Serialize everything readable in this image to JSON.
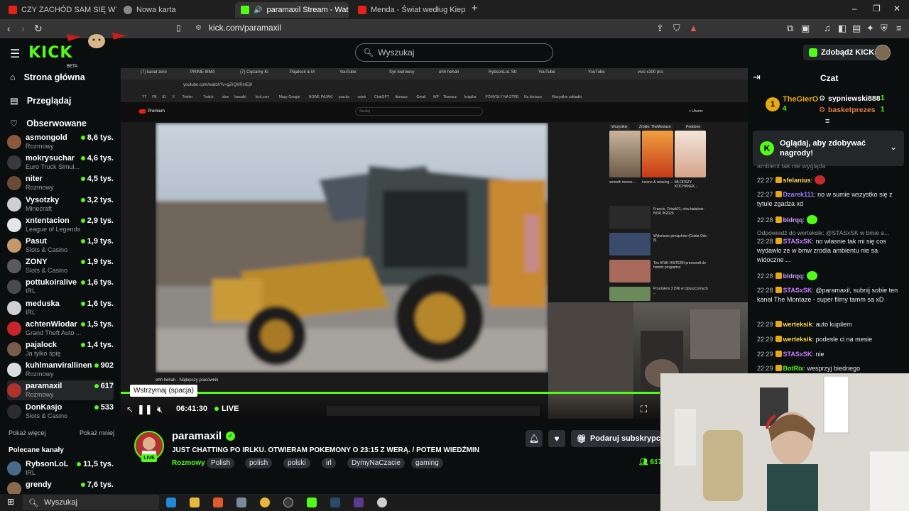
{
  "browser": {
    "tabs": [
      {
        "label": "CZY ZACHÓD SAM SIĘ WYKOŃCZY?",
        "color": "#e62117"
      },
      {
        "label": "Nowa karta",
        "color": "#888"
      },
      {
        "label": "paramaxil Stream - Watch Live",
        "color": "#53fc18"
      },
      {
        "label": "Menda - Świat według Kiepskich - C",
        "color": "#e62117"
      }
    ],
    "url": "kick.com/paramaxil"
  },
  "header": {
    "logo": "KICK",
    "beta": "BETA",
    "search_placeholder": "Wyszukaj",
    "kicks_button": "Zdobądź KICKs"
  },
  "sidebar": {
    "nav": [
      {
        "label": "Strona główna",
        "icon": "home-icon"
      },
      {
        "label": "Przeglądaj",
        "icon": "browse-icon"
      },
      {
        "label": "Obserwowane",
        "icon": "heart-icon"
      }
    ],
    "followed": [
      {
        "name": "asmongold",
        "category": "Rozmowy",
        "viewers": "8,6 tys.",
        "color": "#8b5a3c"
      },
      {
        "name": "mokrysuchar",
        "category": "Euro Truck Simul...",
        "viewers": "4,6 tys.",
        "color": "#3a3a3a"
      },
      {
        "name": "niter",
        "category": "Rozmowy",
        "viewers": "4,5 tys.",
        "color": "#6b4a3a"
      },
      {
        "name": "Vysotzky",
        "category": "Minecraft",
        "viewers": "3,2 tys.",
        "color": "#cfcfcf"
      },
      {
        "name": "xntentacion",
        "category": "League of Legends",
        "viewers": "2,9 tys.",
        "color": "#e6e6e6"
      },
      {
        "name": "Pasut",
        "category": "Slots & Casino",
        "viewers": "1,9 tys.",
        "color": "#c49a6c"
      },
      {
        "name": "ZONY",
        "category": "Slots & Casino",
        "viewers": "1,9 tys.",
        "color": "#5a5a5a"
      },
      {
        "name": "pottukoiralive",
        "category": "IRL",
        "viewers": "1,6 tys.",
        "color": "#4a4a4a"
      },
      {
        "name": "meduska",
        "category": "IRL",
        "viewers": "1,6 tys.",
        "color": "#d0d0d0"
      },
      {
        "name": "achtenWlodar",
        "category": "Grand Theft Auto ...",
        "viewers": "1,5 tys.",
        "color": "#c8262c"
      },
      {
        "name": "pajalock",
        "category": "Ja tylko śpię",
        "viewers": "1,4 tys.",
        "color": "#7a5a4a"
      },
      {
        "name": "kuhlmanvirallinen",
        "category": "Rozmowy",
        "viewers": "902",
        "color": "#dcdcdc"
      },
      {
        "name": "paramaxil",
        "category": "Rozmowy",
        "viewers": "617",
        "color": "#b0322c"
      },
      {
        "name": "DonKasjo",
        "category": "Slots & Casino",
        "viewers": "533",
        "color": "#2c2c2c"
      }
    ],
    "show_more": "Pokaż więcej",
    "show_less": "Pokaż mniej",
    "recommended_title": "Polecane kanały",
    "recommended": [
      {
        "name": "RybsonLoL",
        "category": "IRL",
        "viewers": "11,5 tys.",
        "color": "#4a6a8a"
      },
      {
        "name": "grendy",
        "category": "",
        "viewers": "7,6 tys.",
        "color": "#8a6a4a"
      }
    ]
  },
  "video": {
    "inner_tabs": [
      "(7) kanał zero",
      "PRIME MMA",
      "(7) Ciężarny Ki",
      "Pajalock & M",
      "YouTube",
      "Syn kierowcy",
      "ehh hehah",
      "RybsonLoL Str",
      "YouTube",
      "YouTube",
      "vivo x200 pro"
    ],
    "inner_url": "youtube.com/watch?v=gZrQKRmEj0",
    "bookmarks": [
      "YT",
      "FB",
      "IG",
      "X",
      "Twitter",
      "Twitch",
      "sbm",
      "kawałki",
      "kick.com",
      "Mapy Google",
      "NOWE PAJAKI",
      "pracka",
      "sejek",
      "ChatGPT",
      "tłumacz",
      "Gmail",
      "WP",
      "Tłumacz",
      "książka",
      "POMYSŁY NA STRE",
      "Na bieżąco",
      "Wszystkie zakładki"
    ],
    "yt_search": "Szukaj",
    "yt_premium": "Premium",
    "yt_upload": "+ Utwórz",
    "yt_chips": [
      "Wszystkie",
      "Źródło: TheMontaze",
      "Podobne"
    ],
    "side_items": [
      "smooth moves ...",
      "insane & relaxing ...",
      "MŁODSZY KOCHANEK...",
      "Francis, Oriwik21, nów bałaśnie - NOR IN2026",
      "Wykolunie pimiąchów (Gołda Odc. 8)",
      "Ten ATAK HISTERII przeszedł do historii programu!",
      "Przeżyłem 3 DNI w Opuszczonych ..."
    ],
    "caption": "ehh hehah - Najlepszy pracownik",
    "tooltip": "Wstrzymaj (spacja)",
    "time": "06:41:30",
    "live_label": "LIVE",
    "progress_fraction": 0.86
  },
  "stream": {
    "name": "paramaxil",
    "live_badge": "LIVE",
    "title": "JUST CHATTING PO IRLKU. OTWIERAM POKEMONY O 23:15 Z WERĄ. / POTEM WIEDŹMIN",
    "category": "Rozmowy",
    "tags": [
      "Polish",
      "polish",
      "polski",
      "irl",
      "DymyNaCzacie",
      "gaming"
    ],
    "subscribe_button": "Podaruj subskrypcje",
    "viewers": "617"
  },
  "chat": {
    "title": "Czat",
    "top_gifters": [
      {
        "rank": "1",
        "name": "TheGierO",
        "count": "4"
      },
      {
        "name": "sypniewski888",
        "count": "1"
      },
      {
        "name": "basketprezes",
        "count": "1"
      }
    ],
    "reward_banner": "Oglądaj, aby zdobywać nagrody!",
    "partial_line": "ambient tak nie wygląda",
    "messages": [
      {
        "time": "22:27",
        "user": "sfelanius",
        "color": "#ffd84a",
        "text": ""
      },
      {
        "time": "22:27",
        "user": "Dzarek111",
        "color": "#9b7bff",
        "text": "no w sumie wszystko się z tytule zgadza xd"
      },
      {
        "time": "22:28",
        "user": "bldrqq",
        "color": "#c9a0ff",
        "text": ""
      },
      {
        "time": "22:28",
        "user": "STASxSK",
        "color": "#c77dff",
        "text": "no własnie tak mi się cos wydawlo ze w bmw zrodla ambientu nie sa widoczne ..."
      },
      {
        "time": "22:28",
        "user": "bldrqq",
        "color": "#c9a0ff",
        "text": ""
      },
      {
        "time": "22:28",
        "user": "STASxSK",
        "color": "#c77dff",
        "text": "@paramaxil, subnij sobie ten kanał The Montaze - super filmy tamm sa xD"
      },
      {
        "time": "22:29",
        "user": "werteksik",
        "color": "#ffd84a",
        "text": "auto kupilem"
      },
      {
        "time": "22:29",
        "user": "werteksik",
        "color": "#ffd84a",
        "text": "podesle ci na mesie"
      },
      {
        "time": "22:29",
        "user": "STASxSK",
        "color": "#c77dff",
        "text": "nie"
      },
      {
        "time": "22:29",
        "user": "BotRix",
        "color": "#53fc18",
        "text": "wesprzyj biednego"
      }
    ],
    "reply_to": "Odpowiedź do werteksik: @STASxSK w bmie a..."
  },
  "taskbar": {
    "search_placeholder": "Wyszukaj"
  },
  "colors": {
    "accent": "#53fc18",
    "background": "#0b0e0f",
    "panel": "#24272a"
  }
}
